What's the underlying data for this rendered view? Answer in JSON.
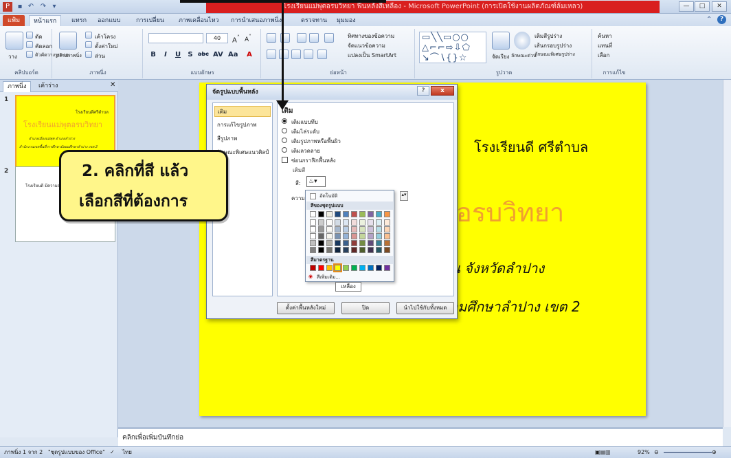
{
  "window": {
    "title": "โรงเรียนแม่พุตอรบวิทยา ฟื้นหลังสีเหลือง - Microsoft PowerPoint (การเปิดใช้งานผลิตภัณฑ์ล้มเหลว)",
    "buttons": {
      "min": "—",
      "max": "□",
      "close": "✕"
    }
  },
  "ribbon": {
    "file_tab": "แฟ้ม",
    "tabs": [
      "หน้าแรก",
      "แทรก",
      "ออกแบบ",
      "การเปลี่ยน",
      "ภาพเคลื่อนไหว",
      "การนำเสนอภาพนิ่ง",
      "ตรวจทาน",
      "มุมมอง"
    ],
    "groups": {
      "clipboard": {
        "label": "คลิปบอร์ด",
        "paste": "วาง",
        "cut": "ตัด",
        "copy": "คัดลอก",
        "format_painter": "ตัวคัดวางรูปแบบ"
      },
      "slides": {
        "label": "ภาพนิ่ง",
        "new_slide": "สร้างภาพนิ่ง",
        "layout": "เค้าโครง",
        "reset": "ตั้งค่าใหม่",
        "section": "ส่วน"
      },
      "font": {
        "label": "แบบอักษร",
        "size": "40"
      },
      "paragraph": {
        "label": "ย่อหน้า",
        "text_direction": "ทิศทางของข้อความ",
        "align_text": "จัดแนวข้อความ",
        "smartart": "แปลงเป็น SmartArt"
      },
      "drawing": {
        "label": "รูปวาด",
        "arrange": "จัดเรียง",
        "quick_styles": "ลักษณะด่วน",
        "fill": "เติมสีรูปร่าง",
        "outline": "เส้นกรอบรูปร่าง",
        "effects": "ลักษณะพิเศษรูปร่าง"
      },
      "editing": {
        "label": "การแก้ไข",
        "find": "ค้นหา",
        "replace": "แทนที่",
        "select": "เลือก"
      }
    }
  },
  "left_pane": {
    "tabs": [
      "ภาพนิ่ง",
      "เค้าร่าง"
    ],
    "close": "✕",
    "slide1": {
      "num": "1",
      "line_top": "โรงเรียนดีศรีตำบล",
      "title": "โรงเรียนแม่พุตอรบวิทยา",
      "line1": "อำเภอเมืองแม่พุต อำเภอลำปาง",
      "line2": "สำนักงานเขตพื้นที่การศึกษามัธยมศึกษาลำปาง เขต 2"
    },
    "slide2": {
      "num": "2",
      "text": "โรงเรียนดี มีความสุข"
    }
  },
  "slide": {
    "line_top": "โรงเรียนดี ศรีตำบล",
    "title_visible": "อรบวิทยา",
    "line_district": "น จังหวัดลำปาง",
    "line_office": "ัถมศึกษาลำปาง เขต 2"
  },
  "dialog": {
    "title": "จัดรูปแบบพื้นหลัง",
    "help": "?",
    "close": "x",
    "nav": [
      "เติม",
      "การแก้ไขรูปภาพ",
      "สีรูปภาพ",
      "ลักษณะพิเศษแนวศิลป์"
    ],
    "section": "เติม",
    "options": [
      "เติมแบบทึบ",
      "เติมไล่ระดับ",
      "เติมรูปภาพหรือพื้นผิว",
      "เติมลวดลาย"
    ],
    "hide_bg": "ซ่อนกราฟิกพื้นหลัง",
    "fill_color_label": "เติมสี",
    "color_short": "สี:",
    "transparency_short": "ความ",
    "buttons": {
      "reset": "ตั้งค่าพื้นหลังใหม่",
      "close": "ปิด",
      "apply_all": "นำไปใช้กับทั้งหมด"
    }
  },
  "picker": {
    "automatic": "อัตโนมัติ",
    "theme_colors": "สีของชุดรูปแบบ",
    "standard_colors": "สีมาตรฐาน",
    "more_colors": "สีเพิ่มเติม...",
    "tooltip": "เหลือง",
    "theme_top": [
      "#ffffff",
      "#000000",
      "#eeece1",
      "#1f497d",
      "#4f81bd",
      "#c0504d",
      "#9bbb59",
      "#8064a2",
      "#4bacc6",
      "#f79646"
    ],
    "standard": [
      "#c00000",
      "#ff0000",
      "#ffc000",
      "#ffff00",
      "#92d050",
      "#00b050",
      "#00b0f0",
      "#0070c0",
      "#002060",
      "#7030a0"
    ]
  },
  "callout": {
    "line1": "2. คลิกที่สี แล้ว",
    "line2": "เลือกสีที่ต้องการ"
  },
  "notes": {
    "placeholder": "คลิกเพื่อเพิ่มบันทึกย่อ"
  },
  "status": {
    "slide_num": "ภาพนิ่ง 1 จาก 2",
    "theme": "\"ชุดรูปแบบของ Office\"",
    "lang": "ไทย",
    "zoom": "92%"
  }
}
